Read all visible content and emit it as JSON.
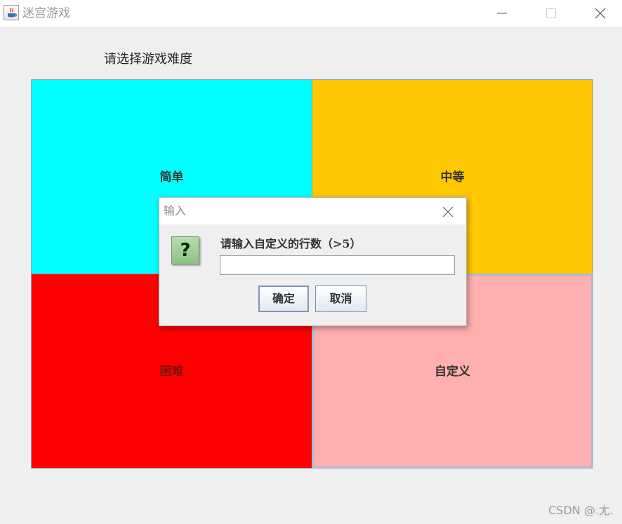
{
  "window": {
    "title": "迷宫游戏",
    "heading": "请选择游戏难度"
  },
  "tiles": {
    "easy": {
      "label": "简单",
      "color": "#00ffff"
    },
    "medium": {
      "label": "中等",
      "color": "#ffc800"
    },
    "hard": {
      "label": "困难",
      "color": "#ff0000"
    },
    "custom": {
      "label": "自定义",
      "color": "#ffafaf"
    }
  },
  "dialog": {
    "title": "输入",
    "icon": "question-icon",
    "icon_glyph": "?",
    "prompt": "请输入自定义的行数（>5）",
    "input_value": "",
    "ok_label": "确定",
    "cancel_label": "取消"
  },
  "watermark": "CSDN @.尢."
}
